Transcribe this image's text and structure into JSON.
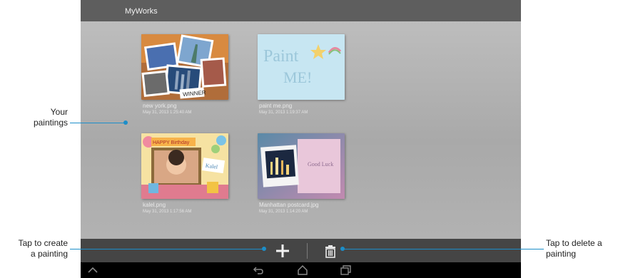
{
  "app": {
    "title": "MyWorks"
  },
  "paintings": [
    {
      "name": "new york.png",
      "date": "May 31, 2013 1:25:40 AM"
    },
    {
      "name": "paint me.png",
      "date": "May 31, 2013 1:19:37 AM"
    },
    {
      "name": "kalel.png",
      "date": "May 31, 2013 1:17:56 AM"
    },
    {
      "name": "Manhattan postcard.jpg",
      "date": "May 31, 2013 1:14:20 AM"
    }
  ],
  "thumbs": {
    "paint_me_text_1": "Paint",
    "paint_me_text_2": "ME!",
    "birthday_banner": "HAPPY Birthday",
    "kalel_sign": "Kalel",
    "postcard_script": "Good Luck",
    "winner_sign": "WINNER"
  },
  "actions": {
    "create": "plus-icon",
    "delete": "trash-icon"
  },
  "callouts": {
    "paintings_line1": "Your",
    "paintings_line2": "paintings",
    "create_line1": "Tap to create",
    "create_line2": "a painting",
    "delete_line1": "Tap to delete a",
    "delete_line2": "painting"
  },
  "colors": {
    "accent": "#1c8ec9",
    "titlebar": "#5e5e5e",
    "actionbar": "#454545"
  }
}
